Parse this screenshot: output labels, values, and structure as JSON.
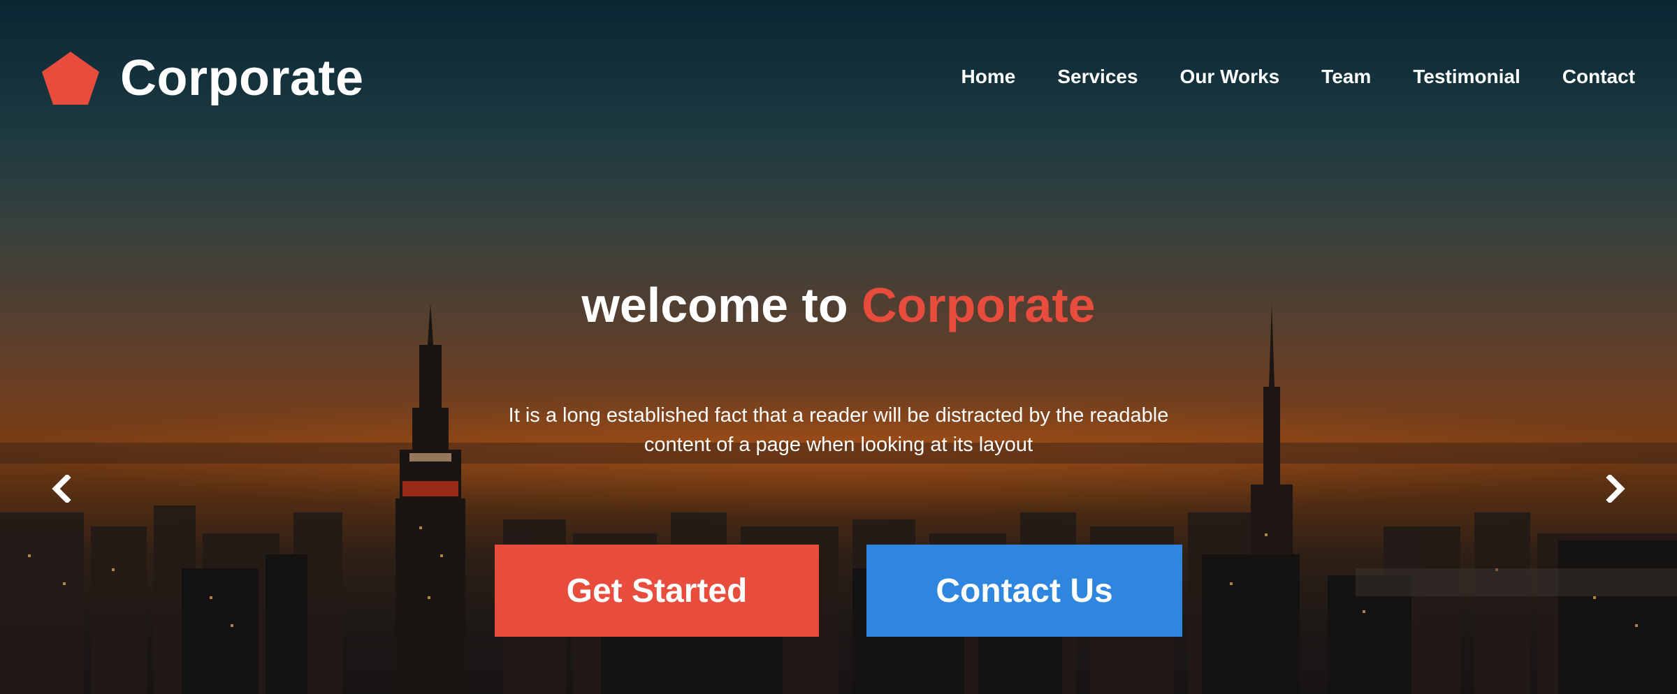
{
  "brand": {
    "name": "Corporate",
    "logo_icon": "pentagon-icon",
    "accent_color": "#e74c3c"
  },
  "nav": {
    "items": [
      {
        "label": "Home"
      },
      {
        "label": "Services"
      },
      {
        "label": "Our Works"
      },
      {
        "label": "Team"
      },
      {
        "label": "Testimonial"
      },
      {
        "label": "Contact"
      }
    ]
  },
  "hero": {
    "headline_prefix": "welcome to",
    "headline_accent": "Corporate",
    "subtext_line1": "It is a long established fact that a reader will be distracted by the readable",
    "subtext_line2": "content of a page when looking at its layout",
    "primary_button": "Get Started",
    "secondary_button": "Contact Us",
    "primary_color": "#e74c3c",
    "secondary_color": "#2e86de",
    "prev_icon": "chevron-left-icon",
    "next_icon": "chevron-right-icon"
  }
}
